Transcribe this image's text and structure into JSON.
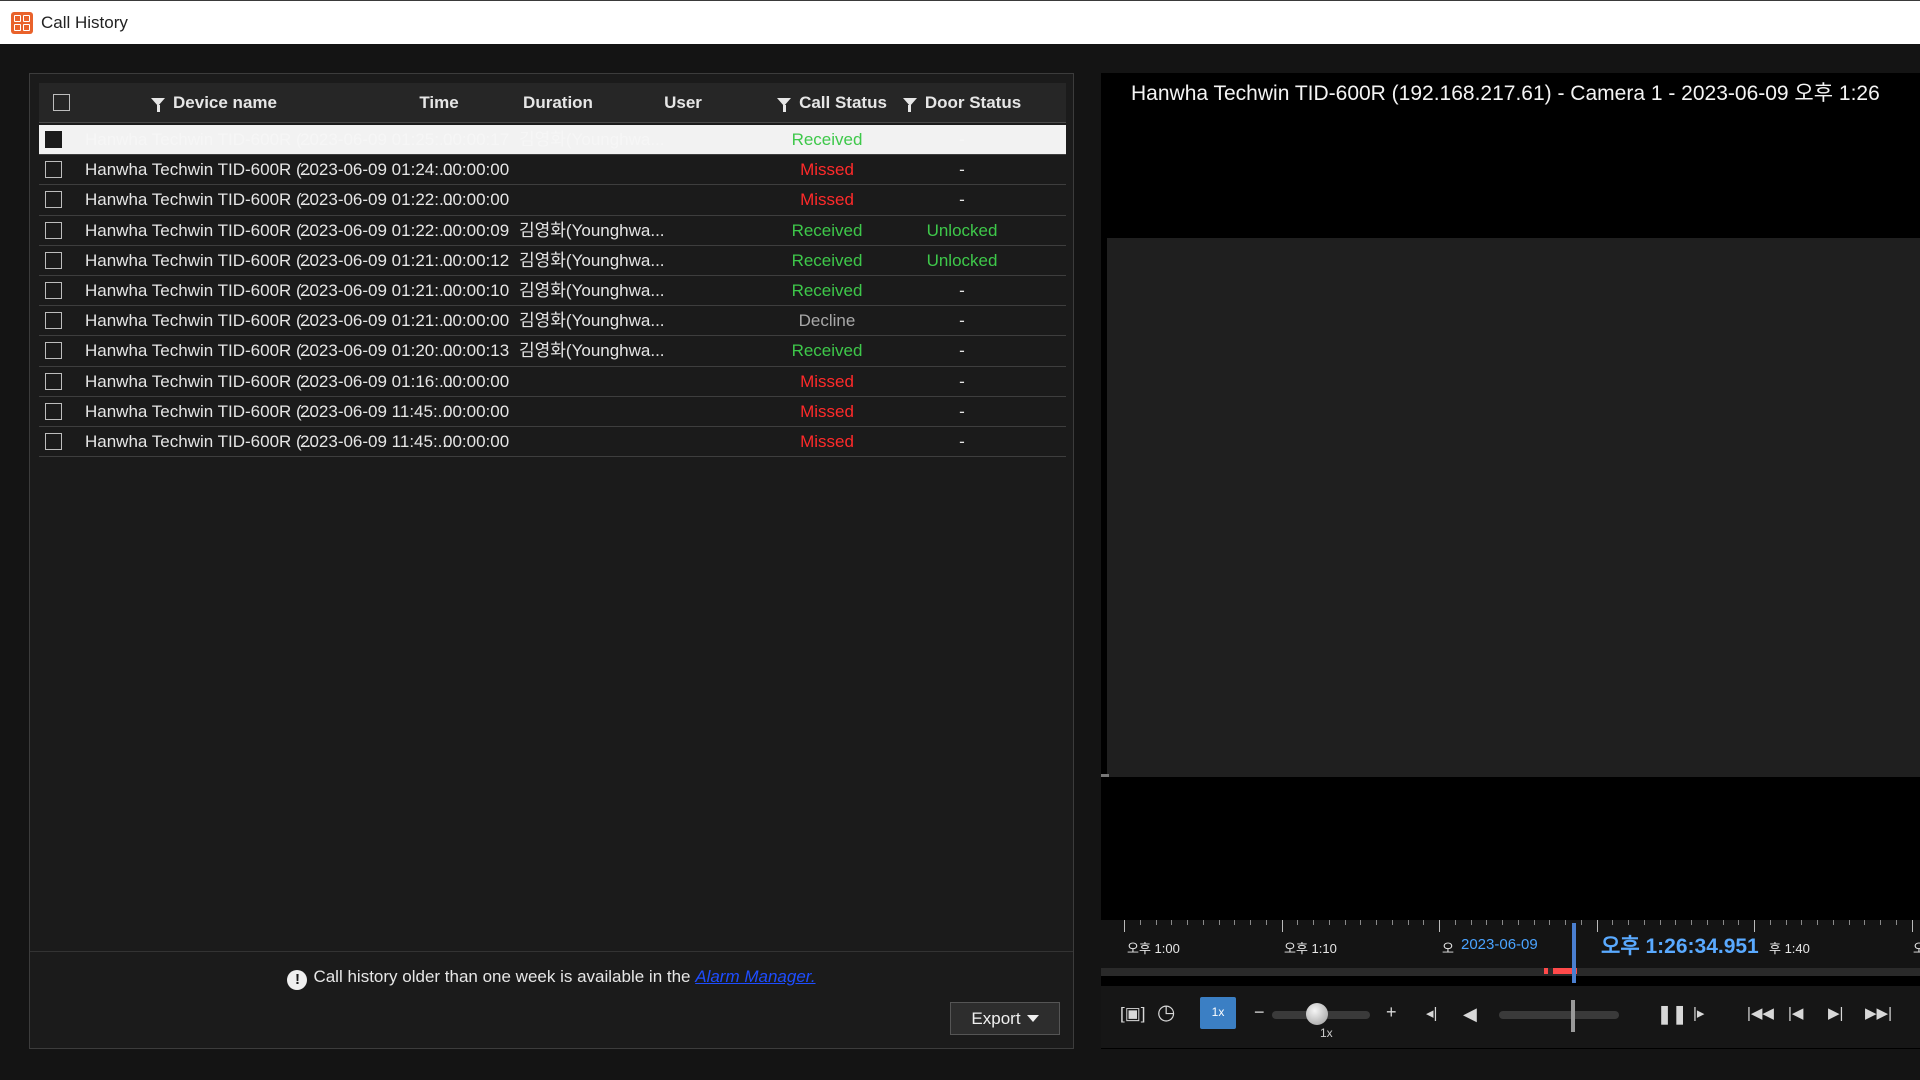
{
  "window": {
    "title": "Call History"
  },
  "table": {
    "headers": {
      "device": "Device name",
      "time": "Time",
      "duration": "Duration",
      "user": "User",
      "call_status": "Call Status",
      "door_status": "Door Status"
    },
    "rows": [
      {
        "device": "Hanwha Techwin TID-600R (...",
        "time": "2023-06-09 01:25:...",
        "duration": "00:00:17",
        "user": "김영화(Younghwa...",
        "call_status": "Received",
        "door_status": "-"
      },
      {
        "device": "Hanwha Techwin TID-600R (...",
        "time": "2023-06-09 01:24:...",
        "duration": "00:00:00",
        "user": "",
        "call_status": "Missed",
        "door_status": "-"
      },
      {
        "device": "Hanwha Techwin TID-600R (...",
        "time": "2023-06-09 01:22:...",
        "duration": "00:00:00",
        "user": "",
        "call_status": "Missed",
        "door_status": "-"
      },
      {
        "device": "Hanwha Techwin TID-600R (...",
        "time": "2023-06-09 01:22:...",
        "duration": "00:00:09",
        "user": "김영화(Younghwa...",
        "call_status": "Received",
        "door_status": "Unlocked"
      },
      {
        "device": "Hanwha Techwin TID-600R (...",
        "time": "2023-06-09 01:21:...",
        "duration": "00:00:12",
        "user": "김영화(Younghwa...",
        "call_status": "Received",
        "door_status": "Unlocked"
      },
      {
        "device": "Hanwha Techwin TID-600R (...",
        "time": "2023-06-09 01:21:...",
        "duration": "00:00:10",
        "user": "김영화(Younghwa...",
        "call_status": "Received",
        "door_status": "-"
      },
      {
        "device": "Hanwha Techwin TID-600R (...",
        "time": "2023-06-09 01:21:...",
        "duration": "00:00:00",
        "user": "김영화(Younghwa...",
        "call_status": "Decline",
        "door_status": "-"
      },
      {
        "device": "Hanwha Techwin TID-600R (...",
        "time": "2023-06-09 01:20:...",
        "duration": "00:00:13",
        "user": "김영화(Younghwa...",
        "call_status": "Received",
        "door_status": "-"
      },
      {
        "device": "Hanwha Techwin TID-600R (...",
        "time": "2023-06-09 01:16:...",
        "duration": "00:00:00",
        "user": "",
        "call_status": "Missed",
        "door_status": "-"
      },
      {
        "device": "Hanwha Techwin TID-600R (...",
        "time": "2023-06-09 11:45:...",
        "duration": "00:00:00",
        "user": "",
        "call_status": "Missed",
        "door_status": "-"
      },
      {
        "device": "Hanwha Techwin TID-600R (...",
        "time": "2023-06-09 11:45:...",
        "duration": "00:00:00",
        "user": "",
        "call_status": "Missed",
        "door_status": "-"
      }
    ],
    "selected_row": 0
  },
  "footer": {
    "info_text": "Call history older than one week is available in the ",
    "info_link": "Alarm Manager.",
    "export_label": "Export"
  },
  "video": {
    "title": "Hanwha Techwin TID-600R (192.168.217.61) - Camera 1 - 2023-06-09 오후 1:26"
  },
  "timeline": {
    "labels": [
      "오후 1:00",
      "오후 1:10",
      "오",
      "후 1:40",
      "오"
    ],
    "date": "2023-06-09",
    "current_prefix": "오후",
    "current_time": "1:26:34.951"
  },
  "controls": {
    "speed_badge": "1x",
    "speed_label": "1x",
    "minus": "−",
    "plus": "+"
  },
  "colors": {
    "received": "#3ec84a",
    "missed": "#ff2a2a",
    "decline": "#a8a8a8",
    "accent": "#3b7fc4"
  }
}
